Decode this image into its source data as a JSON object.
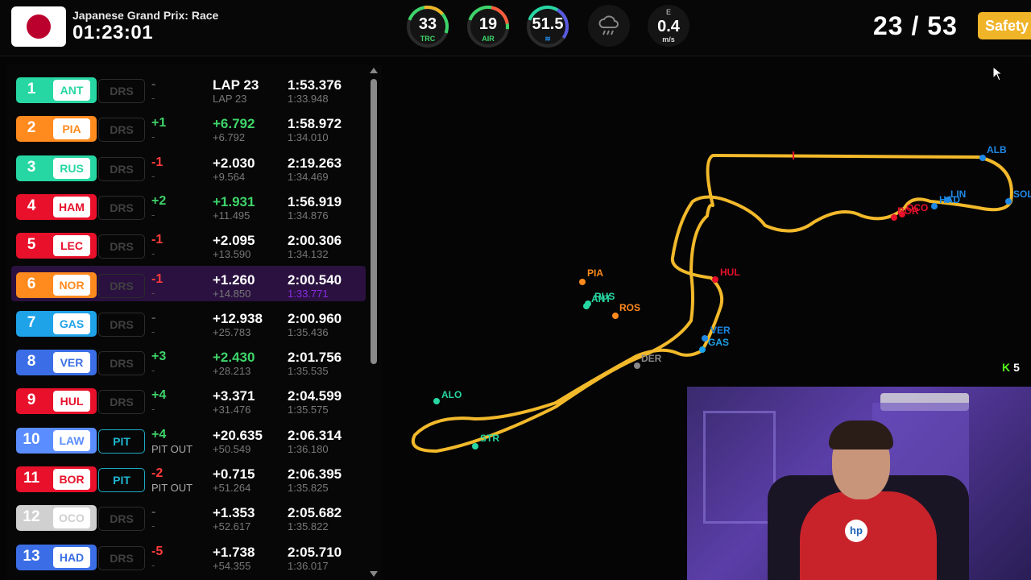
{
  "header": {
    "race_name": "Japanese Grand Prix: Race",
    "race_time": "01:23:01",
    "gauges": [
      {
        "value": "33",
        "label": "TRC",
        "color": "#3ed46a"
      },
      {
        "value": "19",
        "label": "AIR",
        "color": "#3ed46a"
      },
      {
        "value": "51.5",
        "label": "",
        "color": "#1e88e5"
      }
    ],
    "weather_icon": "rain-cloud-icon",
    "wind": {
      "direction": "E",
      "value": "0.4",
      "unit": "m/s"
    },
    "lap": "23 / 53",
    "status": "Safety"
  },
  "leaderboard": [
    {
      "pos": "1",
      "code": "ANT",
      "color": "#27d7a3",
      "drs": "DRS",
      "change": "-",
      "change_class": "muted",
      "sub": "-",
      "gap": "LAP 23",
      "gap_class": "",
      "gap2": "LAP 23",
      "lap": "1:53.376",
      "lap2": "1:33.948"
    },
    {
      "pos": "2",
      "code": "PIA",
      "color": "#ff8a1e",
      "drs": "DRS",
      "change": "+1",
      "change_class": "green",
      "sub": "-",
      "gap": "+6.792",
      "gap_class": "green",
      "gap2": "+6.792",
      "lap": "1:58.972",
      "lap2": "1:34.010"
    },
    {
      "pos": "3",
      "code": "RUS",
      "color": "#27d7a3",
      "drs": "DRS",
      "change": "-1",
      "change_class": "red",
      "sub": "-",
      "gap": "+2.030",
      "gap_class": "",
      "gap2": "+9.564",
      "lap": "2:19.263",
      "lap2": "1:34.469"
    },
    {
      "pos": "4",
      "code": "HAM",
      "color": "#e8102a",
      "drs": "DRS",
      "change": "+2",
      "change_class": "green",
      "sub": "-",
      "gap": "+1.931",
      "gap_class": "green",
      "gap2": "+11.495",
      "lap": "1:56.919",
      "lap2": "1:34.876"
    },
    {
      "pos": "5",
      "code": "LEC",
      "color": "#e8102a",
      "drs": "DRS",
      "change": "-1",
      "change_class": "red",
      "sub": "-",
      "gap": "+2.095",
      "gap_class": "",
      "gap2": "+13.590",
      "lap": "2:00.306",
      "lap2": "1:34.132"
    },
    {
      "pos": "6",
      "code": "NOR",
      "color": "#ff8a1e",
      "drs": "DRS",
      "change": "-1",
      "change_class": "red",
      "sub": "-",
      "gap": "+1.260",
      "gap_class": "",
      "gap2": "+14.850",
      "lap": "2:00.540",
      "lap2": "1:33.771"
    },
    {
      "pos": "7",
      "code": "GAS",
      "color": "#1ea2e8",
      "drs": "DRS",
      "change": "-",
      "change_class": "muted",
      "sub": "-",
      "gap": "+12.938",
      "gap_class": "",
      "gap2": "+25.783",
      "lap": "2:00.960",
      "lap2": "1:35.436"
    },
    {
      "pos": "8",
      "code": "VER",
      "color": "#3b6ee6",
      "drs": "DRS",
      "change": "+3",
      "change_class": "green",
      "sub": "-",
      "gap": "+2.430",
      "gap_class": "green",
      "gap2": "+28.213",
      "lap": "2:01.756",
      "lap2": "1:35.535"
    },
    {
      "pos": "9",
      "code": "HUL",
      "color": "#e8102a",
      "drs": "DRS",
      "change": "+4",
      "change_class": "green",
      "sub": "-",
      "gap": "+3.371",
      "gap_class": "",
      "gap2": "+31.476",
      "lap": "2:04.599",
      "lap2": "1:35.575"
    },
    {
      "pos": "10",
      "code": "LAW",
      "color": "#5a8dff",
      "drs": "PIT",
      "change": "+4",
      "change_class": "green",
      "sub": "PIT OUT",
      "gap": "+20.635",
      "gap_class": "",
      "gap2": "+50.549",
      "lap": "2:06.314",
      "lap2": "1:36.180"
    },
    {
      "pos": "11",
      "code": "BOR",
      "color": "#e8102a",
      "drs": "PIT",
      "change": "-2",
      "change_class": "red",
      "sub": "PIT OUT",
      "gap": "+0.715",
      "gap_class": "",
      "gap2": "+51.264",
      "lap": "2:06.395",
      "lap2": "1:35.825"
    },
    {
      "pos": "12",
      "code": "OCO",
      "color": "#d0d0d0",
      "drs": "DRS",
      "change": "-",
      "change_class": "muted",
      "sub": "-",
      "gap": "+1.353",
      "gap_class": "",
      "gap2": "+52.617",
      "lap": "2:05.682",
      "lap2": "1:35.822"
    },
    {
      "pos": "13",
      "code": "HAD",
      "color": "#3b6ee6",
      "drs": "DRS",
      "change": "-5",
      "change_class": "red",
      "sub": "-",
      "gap": "+1.738",
      "gap_class": "",
      "gap2": "+54.355",
      "lap": "2:05.710",
      "lap2": "1:36.017"
    }
  ],
  "highlight_row": 5,
  "track": {
    "drivers": [
      {
        "code": "ALB",
        "color": "#1e88e5"
      },
      {
        "code": "SOL",
        "color": "#1e88e5"
      },
      {
        "code": "LIN",
        "color": "#1e88e5"
      },
      {
        "code": "HAD",
        "color": "#1e88e5"
      },
      {
        "code": "BOR",
        "color": "#e8102a"
      },
      {
        "code": "OCO",
        "color": "#e8102a"
      },
      {
        "code": "HUL",
        "color": "#e8102a"
      },
      {
        "code": "PIA",
        "color": "#ff8a1e"
      },
      {
        "code": "ANT",
        "color": "#27d7a3"
      },
      {
        "code": "RUS",
        "color": "#27d7a3"
      },
      {
        "code": "ROS",
        "color": "#ff8a1e"
      },
      {
        "code": "VER",
        "color": "#1e88e5"
      },
      {
        "code": "GAS",
        "color": "#1ea2e8"
      },
      {
        "code": "DER",
        "color": "#888888"
      },
      {
        "code": "ALO",
        "color": "#27d7a3"
      },
      {
        "code": "STR",
        "color": "#27d7a3"
      }
    ]
  },
  "overlay": {
    "viewers": "5"
  }
}
